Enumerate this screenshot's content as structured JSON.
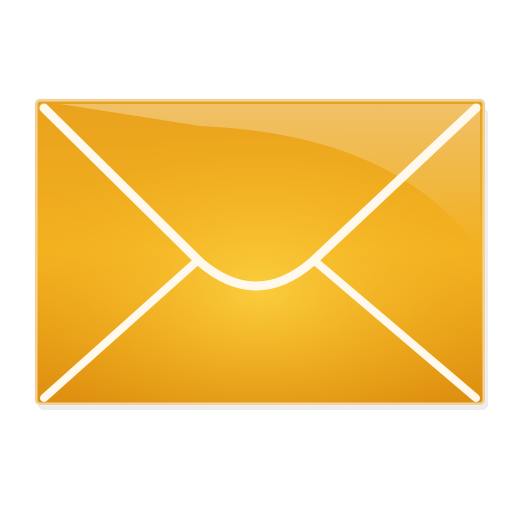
{
  "icon": {
    "name": "envelope-icon",
    "colors": {
      "body_light": "#f7c233",
      "body_mid": "#f0a81c",
      "body_dark": "#d9860b",
      "lines": "#fff8ec",
      "shadow": "#ececec"
    }
  }
}
